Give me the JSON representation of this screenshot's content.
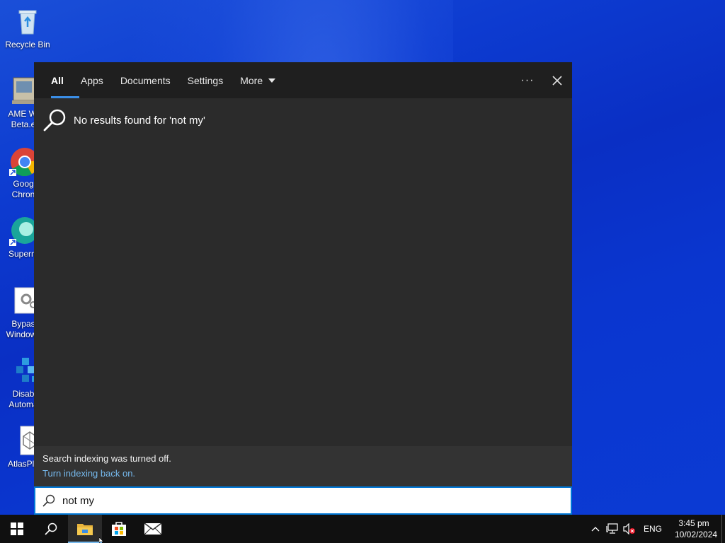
{
  "desktop": {
    "icons": [
      {
        "label": "Recycle Bin",
        "icon": "recycle-bin-icon"
      },
      {
        "label": "AME Wi\nBeta.e",
        "icon": "ame-wizard-icon"
      },
      {
        "label": "Goog\nChron",
        "icon": "chrome-icon"
      },
      {
        "label": "Superm",
        "icon": "supermium-icon"
      },
      {
        "label": "Bypas\nWindows",
        "icon": "bypass-windows-icon"
      },
      {
        "label": "Disab\nAutoma",
        "icon": "disable-automatic-icon"
      },
      {
        "label": "AtlasPla",
        "icon": "atlas-playbook-icon"
      }
    ]
  },
  "search": {
    "tabs": [
      {
        "label": "All",
        "active": true
      },
      {
        "label": "Apps"
      },
      {
        "label": "Documents"
      },
      {
        "label": "Settings"
      },
      {
        "label": "More"
      }
    ],
    "more_options_label": "···",
    "result_message": "No results found for 'not my'",
    "indexing_notice": "Search indexing was turned off.",
    "indexing_link": "Turn indexing back on.",
    "query": "not my "
  },
  "taskbar": {
    "icons": [
      "windows-start-icon",
      "search-icon",
      "file-explorer-icon",
      "microsoft-store-icon",
      "mail-icon"
    ],
    "tray": {
      "language": "ENG",
      "time": "3:45 pm",
      "date": "10/02/2024"
    }
  },
  "colors": {
    "accent": "#0078d7",
    "link": "#76b9ed",
    "panel": "#2b2b2b",
    "nav": "#1f1f1f"
  }
}
